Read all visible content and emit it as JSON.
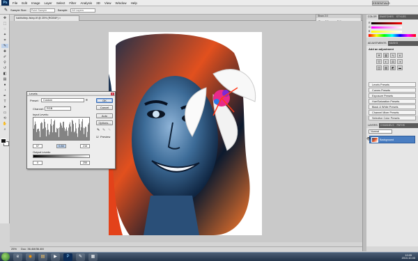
{
  "menubar": {
    "logo": "Ps",
    "items": [
      "File",
      "Edit",
      "Image",
      "Layer",
      "Select",
      "Filter",
      "Analysis",
      "3D",
      "View",
      "Window",
      "Help"
    ],
    "workspace": "ESSENTIALS ▾"
  },
  "options": {
    "sample_size_label": "Sample Size:",
    "sample_size_value": "Point Sample",
    "sample_label": "Sample:",
    "sample_value": "All Layers"
  },
  "document": {
    "tab_title": "hairlishtep-fstep.tif @ 25% (RGB/8*) ×"
  },
  "levels": {
    "title": "Levels",
    "close": "x",
    "preset_label": "Preset:",
    "preset_value": "Custom",
    "channel_label": "Channel:",
    "channel_value": "RGB",
    "input_levels_label": "Input Levels:",
    "input_black": "57",
    "input_gray": "0.84",
    "input_white": "216",
    "output_levels_label": "Output Levels:",
    "output_black": "0",
    "output_white": "255",
    "buttons": [
      "OK",
      "Cancel",
      "Auto",
      "Options..."
    ],
    "preview_label": "Preview"
  },
  "status": {
    "zoom": "25%",
    "doc_info": "Doc: 36.4M/36.4M"
  },
  "right_dock": {
    "color_tabs": [
      "COLOR",
      "SWATCHES",
      "STYLES"
    ],
    "adjust_tabs": [
      "ADJUSTMENTS",
      "MASKS"
    ],
    "add_adjustment": "Add an adjustment",
    "presets": [
      "Levels Presets",
      "Curves Presets",
      "Exposure Presets",
      "Hue/Saturation Presets",
      "Black & White Presets",
      "Channel Mixer Presets",
      "Selective Color Presets"
    ],
    "layer_tabs": [
      "LAYERS",
      "CHANNELS",
      "PATHS"
    ],
    "blend_mode": "Normal",
    "layer_name": "Background"
  },
  "navigator": {
    "title": "Show 2.0",
    "rows": [
      "Show 2.0",
      "Edit",
      "Help"
    ]
  },
  "taskbar": {
    "clock_time": "10:05",
    "clock_date": "2010-10-03"
  },
  "colors": {
    "accent": "#4a7ec2",
    "ok_border": "#3b6fb5"
  }
}
